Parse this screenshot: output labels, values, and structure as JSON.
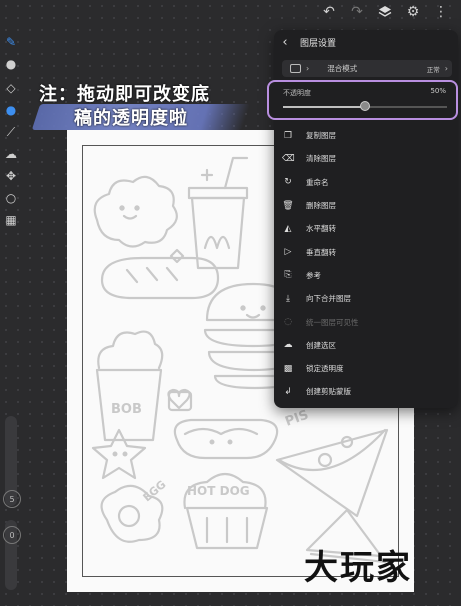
{
  "toolbar": {
    "icons": [
      "undo-icon",
      "redo-icon",
      "layers-icon",
      "settings-icon",
      "more-icon"
    ]
  },
  "panel": {
    "title": "图层设置",
    "blend_label": "混合模式",
    "blend_value": "正常",
    "opacity_label": "不透明度",
    "opacity_value": "50%",
    "opacity_fraction": 0.5,
    "items": [
      {
        "label": "复制图层",
        "icon": "duplicate-icon",
        "enabled": true
      },
      {
        "label": "清除图层",
        "icon": "eraser-icon",
        "enabled": true
      },
      {
        "label": "重命名",
        "icon": "rename-icon",
        "enabled": true
      },
      {
        "label": "删除图层",
        "icon": "trash-icon",
        "enabled": true
      },
      {
        "label": "水平翻转",
        "icon": "flip-horizontal-icon",
        "enabled": true
      },
      {
        "label": "垂直翻转",
        "icon": "flip-vertical-icon",
        "enabled": true
      },
      {
        "label": "参考",
        "icon": "reference-icon",
        "enabled": true
      },
      {
        "label": "向下合并图层",
        "icon": "merge-down-icon",
        "enabled": true
      },
      {
        "label": "统一图层可见性",
        "icon": "visibility-icon",
        "enabled": false
      },
      {
        "label": "创建选区",
        "icon": "selection-icon",
        "enabled": true
      },
      {
        "label": "锁定透明度",
        "icon": "lock-alpha-icon",
        "enabled": true
      },
      {
        "label": "创建剪贴蒙版",
        "icon": "clip-mask-icon",
        "enabled": true
      }
    ]
  },
  "annotation": {
    "line1": "注：拖动即可改变底",
    "line2": "稿的透明度啦"
  },
  "watermark": "大玩家",
  "canvas_text": {
    "bob": "BOB",
    "hotdog": "HOT DOG",
    "egg": "EGG",
    "pizza": "PIS"
  },
  "sidebar": {
    "size_value": "5",
    "opacity_value": "0"
  },
  "colors": {
    "accent": "#3d8ff0",
    "highlight": "#b98fe0",
    "panel_bg": "#1f1f21"
  }
}
